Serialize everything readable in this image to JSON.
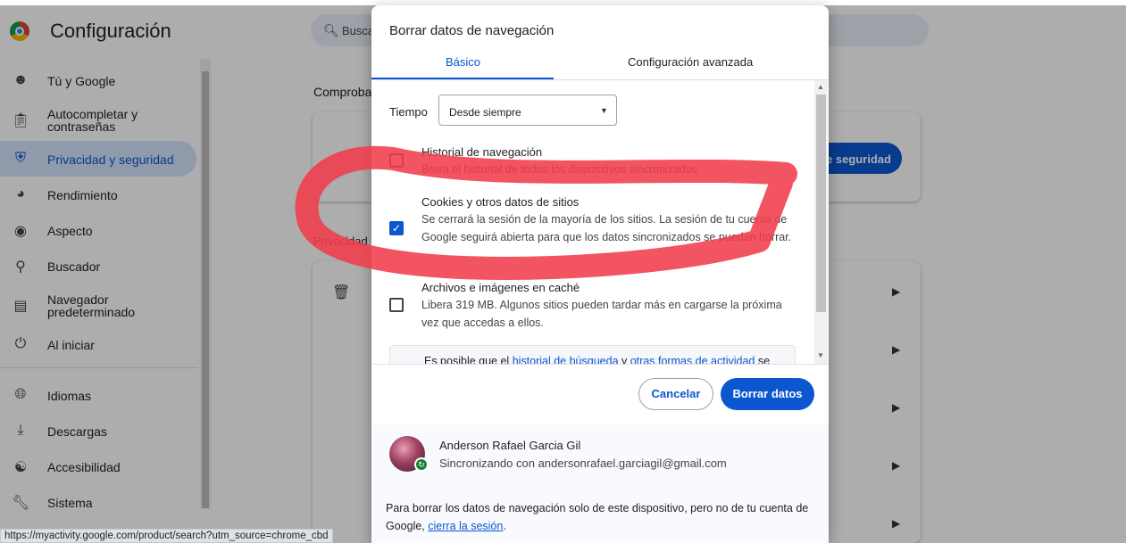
{
  "settings": {
    "app_title": "Configuración",
    "search_placeholder": "Buscar",
    "sidebar": [
      {
        "label": "Tú y Google",
        "icon": "person-icon"
      },
      {
        "label": "Autocompletar y\ncontraseñas",
        "icon": "clipboard-icon"
      },
      {
        "label": "Privacidad y seguridad",
        "icon": "shield-icon",
        "active": true
      },
      {
        "label": "Rendimiento",
        "icon": "speedometer-icon"
      },
      {
        "label": "Aspecto",
        "icon": "palette-icon"
      },
      {
        "label": "Buscador",
        "icon": "search-icon"
      },
      {
        "label": "Navegador\npredeterminado",
        "icon": "browser-icon"
      },
      {
        "label": "Al iniciar",
        "icon": "power-icon"
      },
      {
        "label": "Idiomas",
        "icon": "globe-icon"
      },
      {
        "label": "Descargas",
        "icon": "download-icon"
      },
      {
        "label": "Accesibilidad",
        "icon": "accessibility-icon"
      },
      {
        "label": "Sistema",
        "icon": "wrench-icon"
      }
    ],
    "main_partial_1": "Comproba",
    "main_partial_2": "Privacidad",
    "safety_button": "e seguridad"
  },
  "dialog": {
    "title": "Borrar datos de navegación",
    "tabs": [
      "Básico",
      "Configuración avanzada"
    ],
    "time_label": "Tiempo",
    "time_value": "Desde siempre",
    "items": [
      {
        "title": "Historial de navegación",
        "desc": "Borra el historial de todos los dispositivos sincronizados",
        "checked": false
      },
      {
        "title": "Cookies y otros datos de sitios",
        "desc": "Se cerrará la sesión de la mayoría de los sitios. La sesión de tu cuenta de Google seguirá abierta para que los datos sincronizados se puedan borrar.",
        "checked": true
      },
      {
        "title": "Archivos e imágenes en caché",
        "desc": "Libera 319 MB. Algunos sitios pueden tardar más en cargarse la próxima vez que accedas a ellos.",
        "checked": false
      }
    ],
    "note": {
      "prefix": "Es posible que el ",
      "link1": "historial de búsqueda",
      "mid": " y ",
      "link2": "otras formas de actividad",
      "suffix": " se"
    },
    "cancel_label": "Cancelar",
    "clear_label": "Borrar datos",
    "account": {
      "name": "Anderson Rafael Garcia Gil",
      "sync_text": "Sincronizando con andersonrafael.garciagil@gmail.com",
      "note_prefix": "Para borrar los datos de navegación solo de este dispositivo, pero no de tu cuenta de Google, ",
      "note_link": "cierra la sesión",
      "note_suffix": "."
    }
  },
  "status_url": "https://myactivity.google.com/product/search?utm_source=chrome_cbd",
  "colors": {
    "accent": "#0b57d0",
    "scribble": "#f03c4b"
  }
}
